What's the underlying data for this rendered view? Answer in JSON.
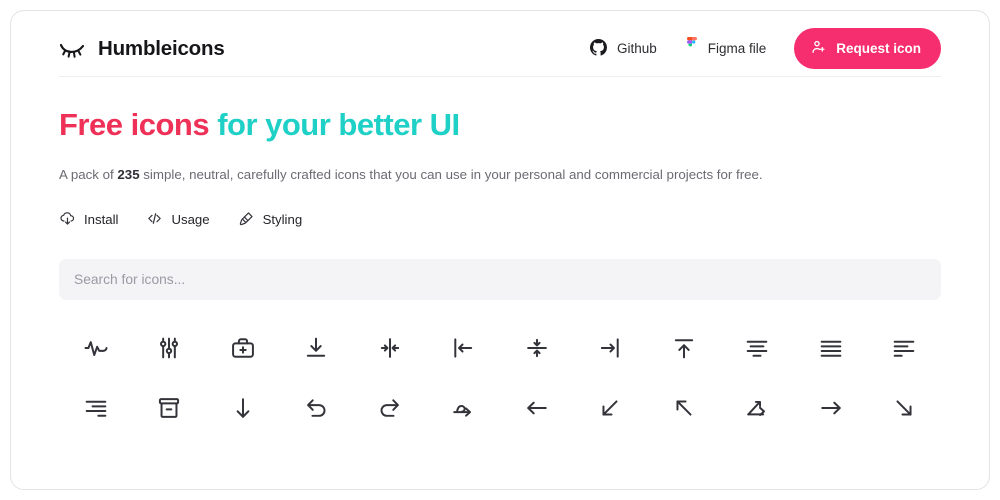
{
  "header": {
    "brand_name": "Humbleicons",
    "brand_logo_icon": "closed-eye-icon",
    "links": [
      {
        "label": "Github",
        "icon": "github-icon"
      },
      {
        "label": "Figma file",
        "icon": "figma-icon"
      }
    ],
    "request_button": {
      "label": "Request icon",
      "icon": "user-add-icon"
    }
  },
  "hero": {
    "title_part1": "Free icons",
    "title_part2": "for your better UI",
    "desc_before": "A pack of ",
    "desc_count": "235",
    "desc_after": " simple, neutral, carefully crafted icons that you can use in your personal and commercial projects for free.",
    "doc_links": [
      {
        "label": "Install",
        "icon": "cloud-download-icon"
      },
      {
        "label": "Usage",
        "icon": "code-icon"
      },
      {
        "label": "Styling",
        "icon": "paint-roller-icon"
      }
    ]
  },
  "search": {
    "placeholder": "Search for icons...",
    "value": ""
  },
  "icon_grid": {
    "columns": 12,
    "icons": [
      {
        "name": "activity-icon"
      },
      {
        "name": "adjustments-icon"
      },
      {
        "name": "first-aid-kit-icon"
      },
      {
        "name": "align-bottom-icon"
      },
      {
        "name": "align-center-horizontal-icon"
      },
      {
        "name": "align-left-icon"
      },
      {
        "name": "align-center-vertical-icon"
      },
      {
        "name": "align-right-icon"
      },
      {
        "name": "align-top-icon"
      },
      {
        "name": "align-text-center-icon"
      },
      {
        "name": "align-text-justify-icon"
      },
      {
        "name": "align-text-left-icon"
      },
      {
        "name": "align-text-right-icon"
      },
      {
        "name": "archive-icon"
      },
      {
        "name": "arrow-down-icon"
      },
      {
        "name": "arrow-curve-left-icon"
      },
      {
        "name": "arrow-curve-right-icon"
      },
      {
        "name": "arrow-jump-right-icon"
      },
      {
        "name": "arrow-left-icon"
      },
      {
        "name": "arrow-down-left-icon"
      },
      {
        "name": "arrow-up-left-icon"
      },
      {
        "name": "arrow-merge-icon"
      },
      {
        "name": "arrow-right-icon"
      },
      {
        "name": "arrow-down-right-icon"
      }
    ]
  },
  "colors": {
    "accent_pink": "#f62d6e",
    "title_pink": "#ef3158",
    "title_teal": "#1ed0c6",
    "icon_stroke": "#33333a",
    "search_bg": "#f4f4f6"
  }
}
